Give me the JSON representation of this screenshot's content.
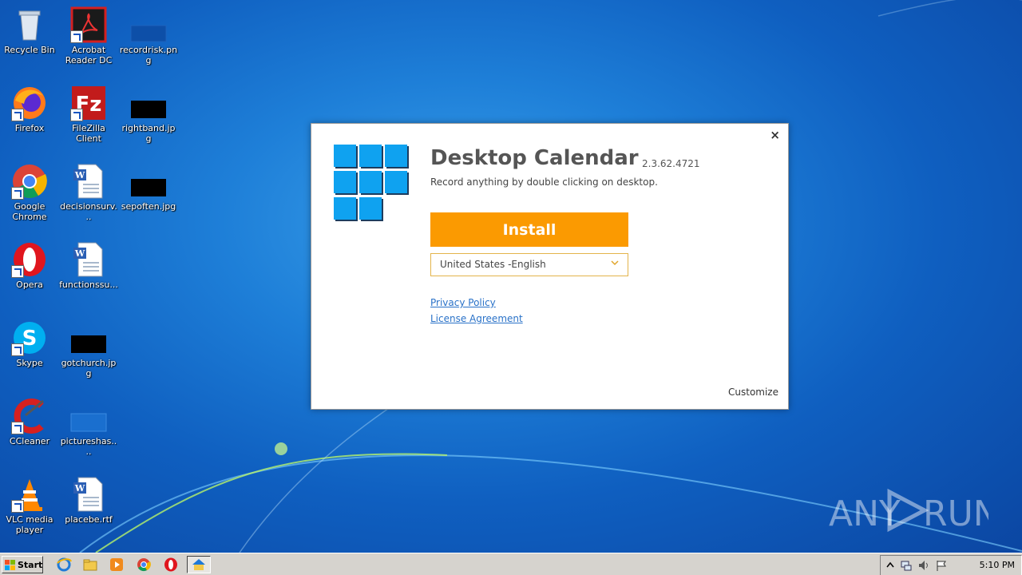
{
  "desktop": {
    "icons": [
      {
        "label": "Recycle Bin"
      },
      {
        "label": "Acrobat Reader DC"
      },
      {
        "label": "recordrisk.png"
      },
      {
        "label": "Firefox"
      },
      {
        "label": "FileZilla Client"
      },
      {
        "label": "rightband.jpg"
      },
      {
        "label": "Google Chrome"
      },
      {
        "label": "decisionsurv..."
      },
      {
        "label": "sepoften.jpg"
      },
      {
        "label": "Opera"
      },
      {
        "label": "functionssu..."
      },
      {
        "label": "Skype"
      },
      {
        "label": "gotchurch.jpg"
      },
      {
        "label": "CCleaner"
      },
      {
        "label": "pictureshas...."
      },
      {
        "label": "VLC media player"
      },
      {
        "label": "placebe.rtf"
      }
    ]
  },
  "dialog": {
    "close": "×",
    "title": "Desktop Calendar",
    "version": "2.3.62.4721",
    "description": "Record anything by double clicking on desktop.",
    "install_label": "Install",
    "language": "United States -English",
    "privacy_policy": "Privacy Policy",
    "license_agreement": "License Agreement",
    "customize": "Customize"
  },
  "watermark": {
    "left": "ANY",
    "right": "RUN"
  },
  "taskbar": {
    "start_label": "Start",
    "clock": "5:10 PM"
  },
  "colors": {
    "install_button": "#fb9a01",
    "logo_tile": "#0fa2f0",
    "link": "#2a72c8"
  }
}
